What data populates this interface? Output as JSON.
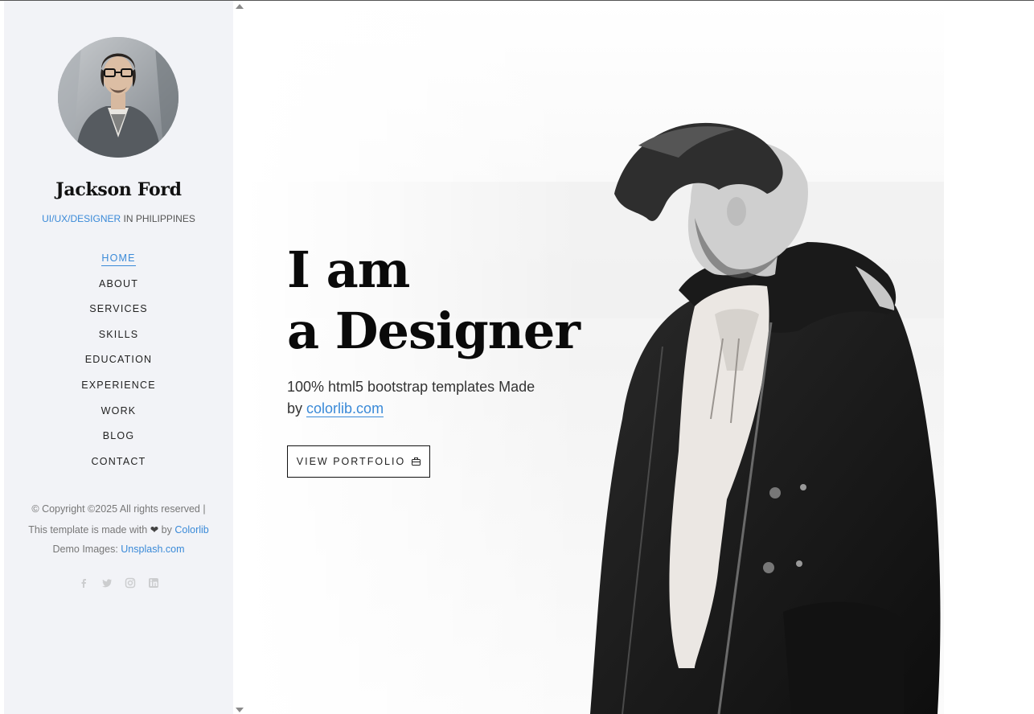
{
  "profile": {
    "name": "Jackson Ford",
    "role_accent": "UI/UX/DESIGNER",
    "role_rest": " IN PHILIPPINES"
  },
  "nav": {
    "items": [
      {
        "label": "HOME",
        "active": true
      },
      {
        "label": "ABOUT"
      },
      {
        "label": "SERVICES"
      },
      {
        "label": "SKILLS"
      },
      {
        "label": "EDUCATION"
      },
      {
        "label": "EXPERIENCE"
      },
      {
        "label": "WORK"
      },
      {
        "label": "BLOG"
      },
      {
        "label": "CONTACT"
      }
    ]
  },
  "footer": {
    "copyright": "© Copyright ©2025 All rights reserved |",
    "made_with_prefix": "This template is made with",
    "heart": "❤",
    "by": "by",
    "colorlib": "Colorlib",
    "demo_prefix": "Demo Images:",
    "unsplash": "Unsplash.com"
  },
  "social": [
    "facebook-icon",
    "twitter-icon",
    "instagram-icon",
    "linkedin-icon"
  ],
  "hero": {
    "headline_line1": "I am",
    "headline_line2": "a Designer",
    "subtitle_text": "100% html5 bootstrap templates Made by",
    "subtitle_link": "colorlib.com",
    "button_label": "VIEW PORTFOLIO",
    "button_icon": "briefcase-icon"
  },
  "colors": {
    "accent": "#3a8ad8",
    "sidebar_bg": "#f2f3f7",
    "text_dark": "#0a0a0a"
  }
}
